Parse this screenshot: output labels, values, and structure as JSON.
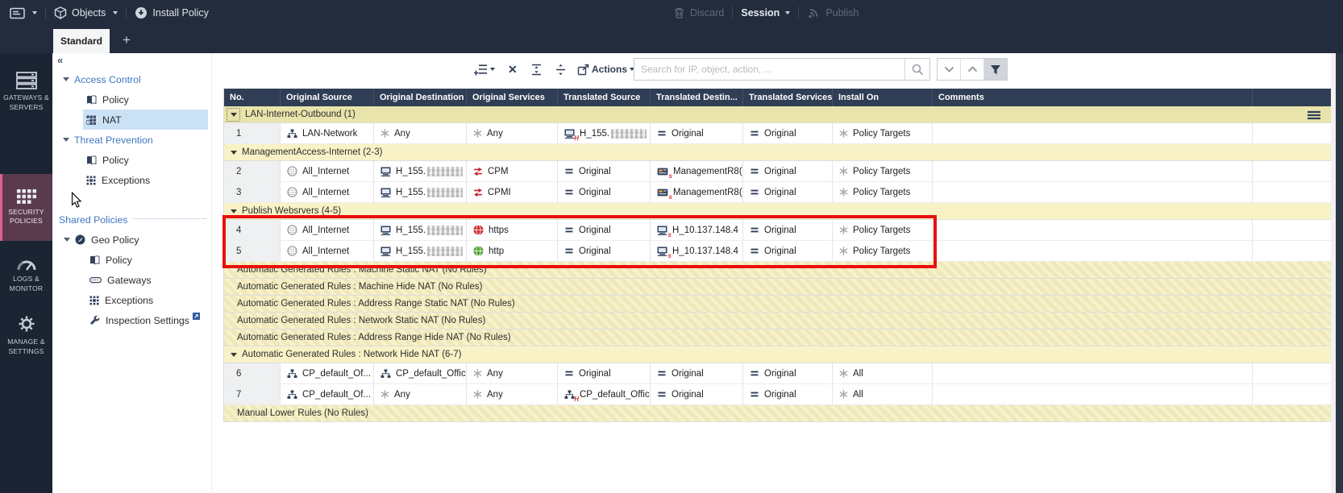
{
  "topbar": {
    "objects_label": "Objects",
    "install_policy_label": "Install Policy",
    "discard_label": "Discard",
    "session_label": "Session",
    "publish_label": "Publish"
  },
  "tabs": {
    "active_tab": "Standard",
    "new_tab_label": "+"
  },
  "sidebar": {
    "items": [
      {
        "label": "GATEWAYS & SERVERS",
        "active": false
      },
      {
        "label": "SECURITY POLICIES",
        "active": true
      },
      {
        "label": "LOGS & MONITOR",
        "active": false
      },
      {
        "label": "MANAGE & SETTINGS",
        "active": false
      }
    ],
    "active_bg": "#5a3b4d",
    "accent": "#e0618d"
  },
  "nav_tree": {
    "items": [
      {
        "label": "Access Control",
        "kind": "group",
        "expanded": true
      },
      {
        "label": "Policy",
        "kind": "child",
        "icon": "policy-book"
      },
      {
        "label": "NAT",
        "kind": "child",
        "icon": "nat-grid",
        "selected": true
      },
      {
        "label": "Threat Prevention",
        "kind": "group",
        "expanded": true
      },
      {
        "label": "Policy",
        "kind": "child",
        "icon": "policy-book"
      },
      {
        "label": "Exceptions",
        "kind": "child",
        "icon": "exceptions-grid"
      },
      {
        "label": "Shared Policies",
        "kind": "header",
        "gap_before": true
      },
      {
        "label": "Geo Policy",
        "kind": "subgroup",
        "icon": "geo-globe",
        "expanded": true
      },
      {
        "label": "Policy",
        "kind": "child2",
        "icon": "policy-book"
      },
      {
        "label": "Gateways",
        "kind": "child2",
        "icon": "gateway"
      },
      {
        "label": "Exceptions",
        "kind": "child2",
        "icon": "exceptions-grid"
      },
      {
        "label": "Inspection Settings",
        "kind": "child2",
        "icon": "wrench",
        "external_badge": true
      }
    ]
  },
  "table_toolbar": {
    "actions_label": "Actions",
    "search_placeholder": "Search for IP, object, action, ..."
  },
  "table": {
    "columns": [
      "No.",
      "Original Source",
      "Original Destination",
      "Original Services",
      "Translated Source",
      "Translated Destin...",
      "Translated Services",
      "Install On",
      "Comments",
      ""
    ],
    "sections": [
      {
        "title": "LAN-Internet-Outbound (1)",
        "style": "selected",
        "expander": true,
        "menu_icon": true,
        "rows": [
          {
            "no": "1",
            "cells": [
              {
                "icon": "network",
                "label": "LAN-Network"
              },
              {
                "icon": "any",
                "label": "Any"
              },
              {
                "icon": "any",
                "label": "Any"
              },
              {
                "icon": "host",
                "sub": "H",
                "label": "H_155.",
                "redacted": true
              },
              {
                "icon": "eq",
                "label": "Original"
              },
              {
                "icon": "eq",
                "label": "Original"
              },
              {
                "icon": "any",
                "label": "Policy Targets"
              }
            ]
          }
        ]
      },
      {
        "title": "ManagementAccess-Internet (2-3)",
        "style": "plain",
        "expander": true,
        "rows": [
          {
            "no": "2",
            "cells": [
              {
                "icon": "inet",
                "label": "All_Internet"
              },
              {
                "icon": "host",
                "label": "H_155.",
                "redacted": true
              },
              {
                "icon": "tcp",
                "label": "CPM"
              },
              {
                "icon": "eq",
                "label": "Original"
              },
              {
                "icon": "gateway-host",
                "sub": "s",
                "label": "ManagementR8("
              },
              {
                "icon": "eq",
                "label": "Original"
              },
              {
                "icon": "any",
                "label": "Policy Targets"
              }
            ]
          },
          {
            "no": "3",
            "cells": [
              {
                "icon": "inet",
                "label": "All_Internet"
              },
              {
                "icon": "host",
                "label": "H_155.",
                "redacted": true
              },
              {
                "icon": "tcp",
                "label": "CPMI"
              },
              {
                "icon": "eq",
                "label": "Original"
              },
              {
                "icon": "gateway-host",
                "sub": "s",
                "label": "ManagementR8("
              },
              {
                "icon": "eq",
                "label": "Original"
              },
              {
                "icon": "any",
                "label": "Policy Targets"
              }
            ]
          }
        ]
      },
      {
        "title": "Publish Websrvers (4-5)",
        "style": "plain",
        "expander": true,
        "rows": [
          {
            "no": "4",
            "cells": [
              {
                "icon": "inet",
                "label": "All_Internet"
              },
              {
                "icon": "host",
                "label": "H_155.",
                "redacted": true
              },
              {
                "icon": "https",
                "label": "https"
              },
              {
                "icon": "eq",
                "label": "Original"
              },
              {
                "icon": "host",
                "sub": "s",
                "label": "H_10.137.148.4"
              },
              {
                "icon": "eq",
                "label": "Original"
              },
              {
                "icon": "any",
                "label": "Policy Targets"
              }
            ]
          },
          {
            "no": "5",
            "cells": [
              {
                "icon": "inet",
                "label": "All_Internet"
              },
              {
                "icon": "host",
                "label": "H_155.",
                "redacted": true
              },
              {
                "icon": "http",
                "label": "http"
              },
              {
                "icon": "eq",
                "label": "Original"
              },
              {
                "icon": "host",
                "sub": "s",
                "label": "H_10.137.148.4"
              },
              {
                "icon": "eq",
                "label": "Original"
              },
              {
                "icon": "any",
                "label": "Policy Targets"
              }
            ]
          }
        ]
      },
      {
        "title": "Automatic Generated Rules : Machine Static NAT (No Rules)",
        "style": "hatched"
      },
      {
        "title": "Automatic Generated Rules : Machine Hide NAT (No Rules)",
        "style": "hatched"
      },
      {
        "title": "Automatic Generated Rules : Address Range Static NAT (No Rules)",
        "style": "hatched"
      },
      {
        "title": "Automatic Generated Rules : Network Static NAT (No Rules)",
        "style": "hatched"
      },
      {
        "title": "Automatic Generated Rules : Address Range Hide NAT (No Rules)",
        "style": "hatched"
      },
      {
        "title": "Automatic Generated Rules : Network Hide NAT (6-7)",
        "style": "plain",
        "expander": true,
        "rows": [
          {
            "no": "6",
            "cells": [
              {
                "icon": "network",
                "label": "CP_default_Of..."
              },
              {
                "icon": "network",
                "label": "CP_default_Offic"
              },
              {
                "icon": "any",
                "label": "Any"
              },
              {
                "icon": "eq",
                "label": "Original"
              },
              {
                "icon": "eq",
                "label": "Original"
              },
              {
                "icon": "eq",
                "label": "Original"
              },
              {
                "icon": "any",
                "label": "All"
              }
            ]
          },
          {
            "no": "7",
            "cells": [
              {
                "icon": "network",
                "label": "CP_default_Of..."
              },
              {
                "icon": "any",
                "label": "Any"
              },
              {
                "icon": "any",
                "label": "Any"
              },
              {
                "icon": "network",
                "sub": "H",
                "label": "CP_default_Offic"
              },
              {
                "icon": "eq",
                "label": "Original"
              },
              {
                "icon": "eq",
                "label": "Original"
              },
              {
                "icon": "any",
                "label": "All"
              }
            ]
          }
        ]
      },
      {
        "title": "Manual Lower Rules (No Rules)",
        "style": "hatched"
      }
    ]
  },
  "annotation": {
    "color": "#e8100c"
  },
  "colors": {
    "topbar_bg": "#222c3d",
    "sidebar_bg": "#1b2433",
    "table_header_bg": "#2f3e55",
    "section_bg": "#f8f2c6",
    "section_selected_bg": "#e9e4ab",
    "nat_selected_bg": "#cbe2f6",
    "link_blue": "#3f78bf"
  }
}
